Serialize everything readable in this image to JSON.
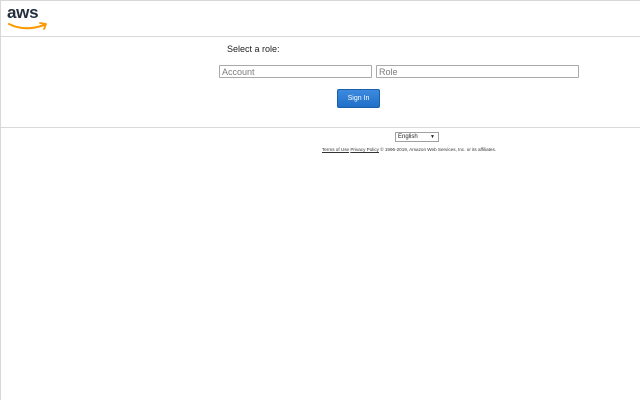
{
  "header": {
    "logo_text": "aws",
    "logo_smile_color": "#ff9900"
  },
  "form": {
    "role_label": "Select a role:",
    "account_placeholder": "Account",
    "role_placeholder": "Role",
    "signin_label": "Sign In",
    "button_color": "#2a7ad5"
  },
  "language": {
    "selected": "English",
    "caret": "▼"
  },
  "footer": {
    "terms_link": "Terms of Use",
    "privacy_link": "Privacy Policy",
    "copyright": "© 1996-2019, Amazon Web Services, Inc. or its affiliates."
  }
}
